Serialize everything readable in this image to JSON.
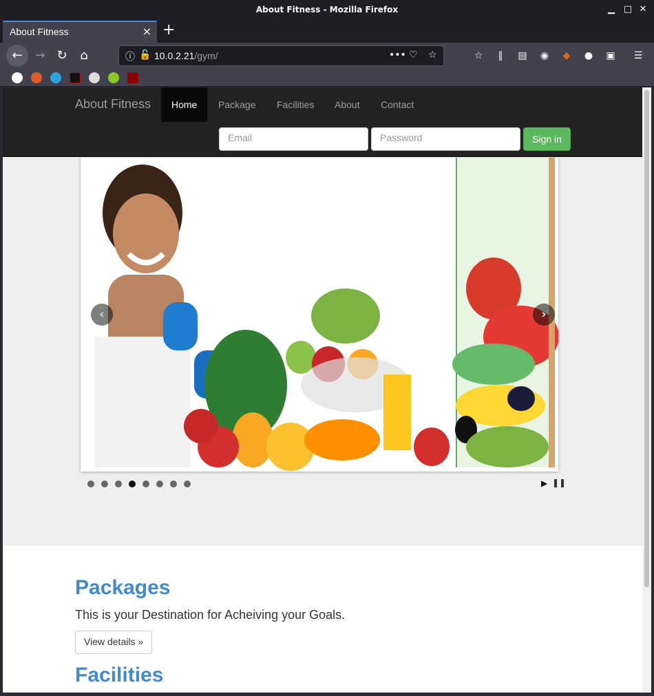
{
  "window": {
    "title": "About Fitness - Mozilla Firefox"
  },
  "tab": {
    "title": "About Fitness"
  },
  "urlbar": {
    "host": "10.0.2.21",
    "path": "/gym/"
  },
  "site": {
    "brand": "About Fitness",
    "nav": [
      "Home",
      "Package",
      "Facilities",
      "About",
      "Contact"
    ],
    "email_placeholder": "Email",
    "password_placeholder": "Password",
    "signin_label": "Sign in"
  },
  "slider": {
    "slides": 8,
    "active_slide_index": 3
  },
  "sections": {
    "packages_title": "Packages",
    "packages_text": "This is your Destination for Acheiving your Goals.",
    "details_label": "View details »",
    "facilities_title": "Facilities"
  }
}
